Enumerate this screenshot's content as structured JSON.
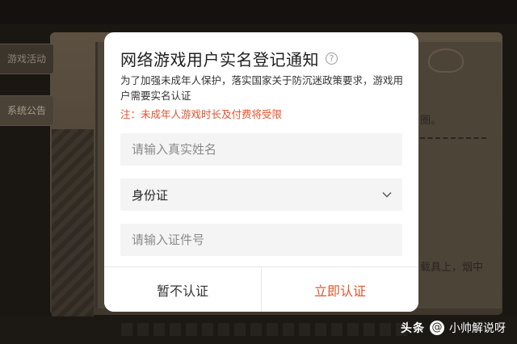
{
  "background": {
    "side_tabs": [
      "游戏活动",
      "系统公告"
    ],
    "text_fragments": [
      "圈。",
      "载具上，烟中"
    ]
  },
  "dialog": {
    "title": "网络游戏用户实名登记通知",
    "help_icon": "question-circle-icon",
    "description": "为了加强未成年人保护，落实国家关于防沉迷政策要求，游戏用户需要实名认证",
    "notice": "注：未成年人游戏时长及付费将受限",
    "name_field": {
      "placeholder": "请输入真实姓名",
      "value": ""
    },
    "id_type_select": {
      "selected": "身份证",
      "icon": "chevron-down-icon"
    },
    "id_number_field": {
      "placeholder": "请输入证件号",
      "value": ""
    },
    "buttons": {
      "skip": "暂不认证",
      "verify": "立即认证"
    }
  },
  "watermark": {
    "brand": "头条",
    "account": "小帅解说呀"
  },
  "colors": {
    "accent": "#e5552c",
    "field_bg": "#f4f4f4",
    "overlay": "#1a1713"
  }
}
